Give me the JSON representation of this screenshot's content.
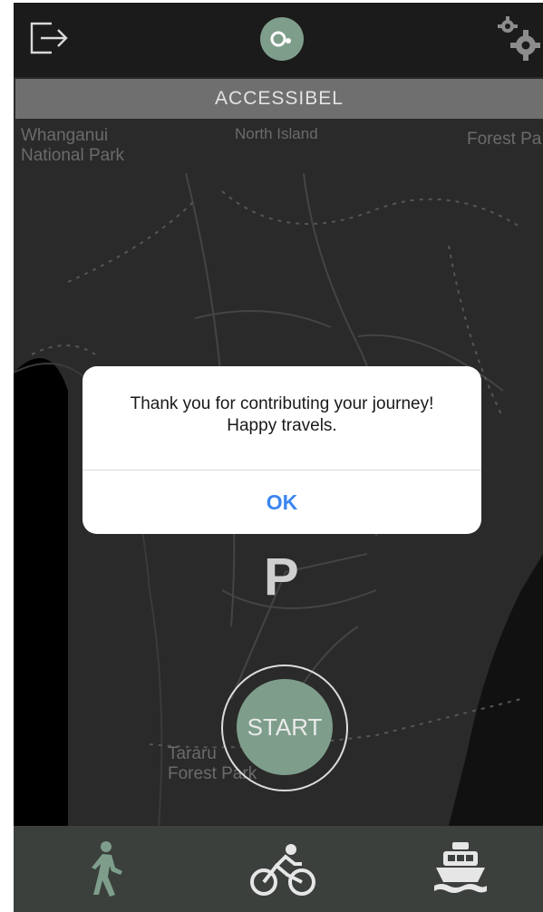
{
  "header": {
    "logout_icon": "logout-icon",
    "logo_icon": "app-logo-icon",
    "settings_icon": "gear-icon"
  },
  "banner": {
    "title": "ACCESSIBEL"
  },
  "map": {
    "labels": [
      "Whanganui\nNational Park",
      "North Island",
      "Forest Pa",
      "Tararu\nForest Park"
    ],
    "parking_label": "P"
  },
  "start_button": {
    "label": "START"
  },
  "dialog": {
    "message": "Thank you for contributing your journey!\nHappy travels.",
    "ok_label": "OK"
  },
  "bottom_nav": {
    "items": [
      {
        "icon": "walking-icon",
        "active": true,
        "color": "#7e9e8b"
      },
      {
        "icon": "cycling-icon",
        "active": false,
        "color": "#e6e6e6"
      },
      {
        "icon": "ferry-icon",
        "active": false,
        "color": "#e6e6e6"
      }
    ]
  },
  "colors": {
    "accent": "#7e9e8b",
    "link_blue": "#3b86f0",
    "map_background": "#2a2a2a",
    "banner_background": "#6f6f6f"
  }
}
